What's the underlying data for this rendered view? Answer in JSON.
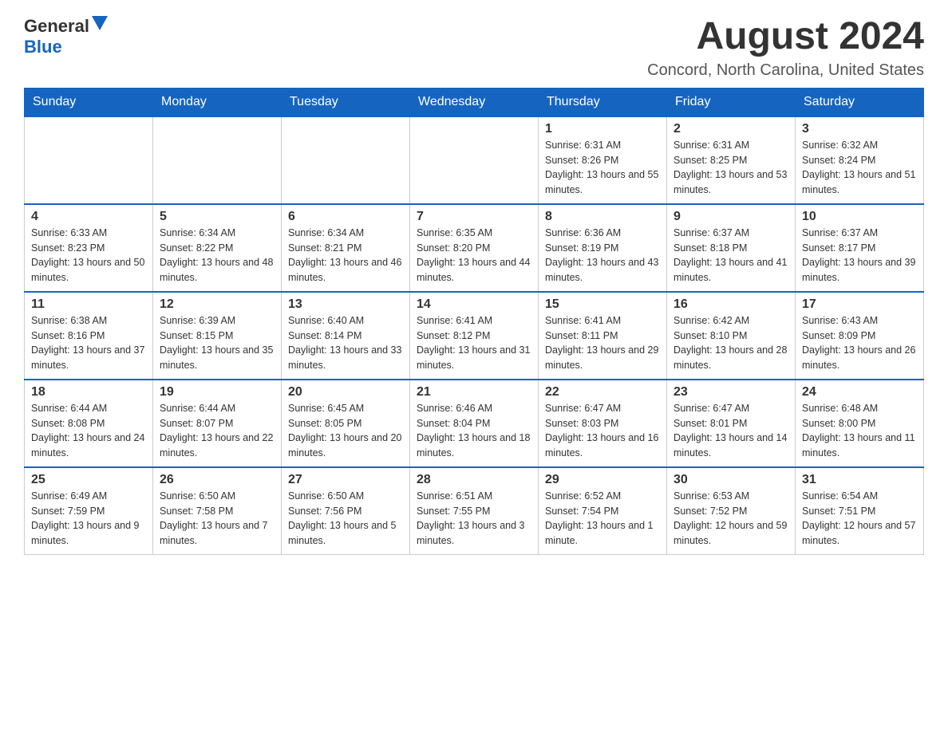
{
  "header": {
    "logo_general": "General",
    "logo_blue": "Blue",
    "month_title": "August 2024",
    "location": "Concord, North Carolina, United States"
  },
  "weekdays": [
    "Sunday",
    "Monday",
    "Tuesday",
    "Wednesday",
    "Thursday",
    "Friday",
    "Saturday"
  ],
  "weeks": [
    [
      {
        "day": "",
        "info": ""
      },
      {
        "day": "",
        "info": ""
      },
      {
        "day": "",
        "info": ""
      },
      {
        "day": "",
        "info": ""
      },
      {
        "day": "1",
        "info": "Sunrise: 6:31 AM\nSunset: 8:26 PM\nDaylight: 13 hours and 55 minutes."
      },
      {
        "day": "2",
        "info": "Sunrise: 6:31 AM\nSunset: 8:25 PM\nDaylight: 13 hours and 53 minutes."
      },
      {
        "day": "3",
        "info": "Sunrise: 6:32 AM\nSunset: 8:24 PM\nDaylight: 13 hours and 51 minutes."
      }
    ],
    [
      {
        "day": "4",
        "info": "Sunrise: 6:33 AM\nSunset: 8:23 PM\nDaylight: 13 hours and 50 minutes."
      },
      {
        "day": "5",
        "info": "Sunrise: 6:34 AM\nSunset: 8:22 PM\nDaylight: 13 hours and 48 minutes."
      },
      {
        "day": "6",
        "info": "Sunrise: 6:34 AM\nSunset: 8:21 PM\nDaylight: 13 hours and 46 minutes."
      },
      {
        "day": "7",
        "info": "Sunrise: 6:35 AM\nSunset: 8:20 PM\nDaylight: 13 hours and 44 minutes."
      },
      {
        "day": "8",
        "info": "Sunrise: 6:36 AM\nSunset: 8:19 PM\nDaylight: 13 hours and 43 minutes."
      },
      {
        "day": "9",
        "info": "Sunrise: 6:37 AM\nSunset: 8:18 PM\nDaylight: 13 hours and 41 minutes."
      },
      {
        "day": "10",
        "info": "Sunrise: 6:37 AM\nSunset: 8:17 PM\nDaylight: 13 hours and 39 minutes."
      }
    ],
    [
      {
        "day": "11",
        "info": "Sunrise: 6:38 AM\nSunset: 8:16 PM\nDaylight: 13 hours and 37 minutes."
      },
      {
        "day": "12",
        "info": "Sunrise: 6:39 AM\nSunset: 8:15 PM\nDaylight: 13 hours and 35 minutes."
      },
      {
        "day": "13",
        "info": "Sunrise: 6:40 AM\nSunset: 8:14 PM\nDaylight: 13 hours and 33 minutes."
      },
      {
        "day": "14",
        "info": "Sunrise: 6:41 AM\nSunset: 8:12 PM\nDaylight: 13 hours and 31 minutes."
      },
      {
        "day": "15",
        "info": "Sunrise: 6:41 AM\nSunset: 8:11 PM\nDaylight: 13 hours and 29 minutes."
      },
      {
        "day": "16",
        "info": "Sunrise: 6:42 AM\nSunset: 8:10 PM\nDaylight: 13 hours and 28 minutes."
      },
      {
        "day": "17",
        "info": "Sunrise: 6:43 AM\nSunset: 8:09 PM\nDaylight: 13 hours and 26 minutes."
      }
    ],
    [
      {
        "day": "18",
        "info": "Sunrise: 6:44 AM\nSunset: 8:08 PM\nDaylight: 13 hours and 24 minutes."
      },
      {
        "day": "19",
        "info": "Sunrise: 6:44 AM\nSunset: 8:07 PM\nDaylight: 13 hours and 22 minutes."
      },
      {
        "day": "20",
        "info": "Sunrise: 6:45 AM\nSunset: 8:05 PM\nDaylight: 13 hours and 20 minutes."
      },
      {
        "day": "21",
        "info": "Sunrise: 6:46 AM\nSunset: 8:04 PM\nDaylight: 13 hours and 18 minutes."
      },
      {
        "day": "22",
        "info": "Sunrise: 6:47 AM\nSunset: 8:03 PM\nDaylight: 13 hours and 16 minutes."
      },
      {
        "day": "23",
        "info": "Sunrise: 6:47 AM\nSunset: 8:01 PM\nDaylight: 13 hours and 14 minutes."
      },
      {
        "day": "24",
        "info": "Sunrise: 6:48 AM\nSunset: 8:00 PM\nDaylight: 13 hours and 11 minutes."
      }
    ],
    [
      {
        "day": "25",
        "info": "Sunrise: 6:49 AM\nSunset: 7:59 PM\nDaylight: 13 hours and 9 minutes."
      },
      {
        "day": "26",
        "info": "Sunrise: 6:50 AM\nSunset: 7:58 PM\nDaylight: 13 hours and 7 minutes."
      },
      {
        "day": "27",
        "info": "Sunrise: 6:50 AM\nSunset: 7:56 PM\nDaylight: 13 hours and 5 minutes."
      },
      {
        "day": "28",
        "info": "Sunrise: 6:51 AM\nSunset: 7:55 PM\nDaylight: 13 hours and 3 minutes."
      },
      {
        "day": "29",
        "info": "Sunrise: 6:52 AM\nSunset: 7:54 PM\nDaylight: 13 hours and 1 minute."
      },
      {
        "day": "30",
        "info": "Sunrise: 6:53 AM\nSunset: 7:52 PM\nDaylight: 12 hours and 59 minutes."
      },
      {
        "day": "31",
        "info": "Sunrise: 6:54 AM\nSunset: 7:51 PM\nDaylight: 12 hours and 57 minutes."
      }
    ]
  ]
}
